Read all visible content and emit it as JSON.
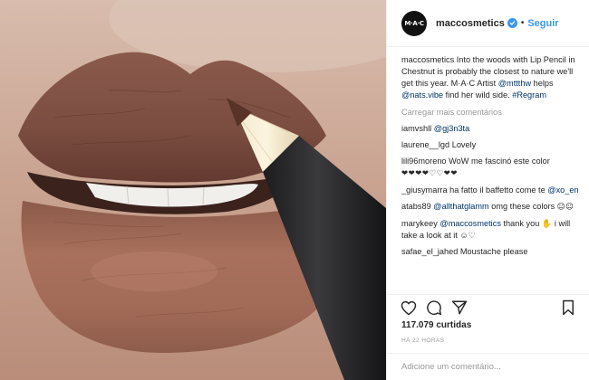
{
  "header": {
    "avatar_text": "M·A·C",
    "username": "maccosmetics",
    "separator": "•",
    "follow_label": "Seguir"
  },
  "caption": {
    "username": "maccosmetics",
    "text_1": " Into the woods with Lip Pencil in Chestnut is probably the closest to nature we'll get this year. M·A·C Artist ",
    "mention_1": "@mttthw",
    "text_2": " helps ",
    "mention_2": "@nats.vibe",
    "text_3": " find her wild side. ",
    "hashtag": "#Regram"
  },
  "load_more": "Carregar mais comentários",
  "comments": [
    {
      "username": "iamvshll",
      "mention": "@gj3n3ta",
      "text": ""
    },
    {
      "username": "laurene__lgd",
      "mention": "",
      "text": "Lovely"
    },
    {
      "username": "lili96moreno",
      "mention": "",
      "text": "WoW me fascinó este color",
      "glyphs": "❤❤❤❤♡♡❤❤"
    },
    {
      "username": "_giusymarra",
      "mention": "",
      "text": "ha fatto il baffetto come te",
      "mention_after": "@xo_en"
    },
    {
      "username": "atabs89",
      "mention": "@allthatglamm",
      "text": "omg these colors",
      "glyphs": "☺☺"
    },
    {
      "username": "marykeey",
      "mention": "@maccosmetics",
      "text": "thank you ✋ i will take a look at it ☺♡"
    },
    {
      "username": "safae_el_jahed",
      "mention": "",
      "text": "Moustache please"
    }
  ],
  "icons": {
    "like": "heart-icon",
    "comment": "comment-icon",
    "share": "share-icon",
    "save": "bookmark-icon"
  },
  "likes": "117.079 curtidas",
  "time": "HÁ 22 HORAS",
  "add_comment": {
    "placeholder": "Adicione um comentário..."
  },
  "colors": {
    "accent": "#3897f0",
    "mention": "#003569",
    "muted": "#999999",
    "text": "#262626"
  }
}
